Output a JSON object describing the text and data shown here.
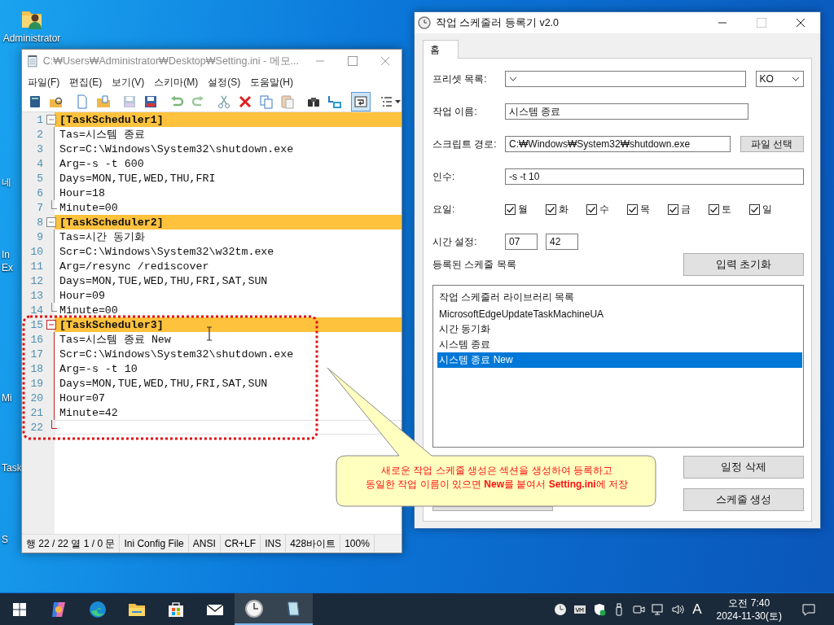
{
  "desktop": {
    "icons": [
      {
        "label": "Administrator"
      }
    ],
    "edge_labels": [
      "네",
      "In",
      "Ex",
      "Mi",
      "Task",
      "S"
    ]
  },
  "notepad": {
    "title": "C:₩Users₩Administrator₩Desktop₩Setting.ini - 메모...",
    "menu": [
      "파일(F)",
      "편집(E)",
      "보기(V)",
      "스키마(M)",
      "설정(S)",
      "도움말(H)"
    ],
    "toolbar": [
      {
        "kind": "book",
        "pressed": false
      },
      {
        "kind": "open",
        "pressed": false
      },
      {
        "kind": "sep"
      },
      {
        "kind": "new",
        "pressed": false
      },
      {
        "kind": "folder",
        "pressed": false
      },
      {
        "kind": "sep"
      },
      {
        "kind": "save-grey",
        "pressed": false
      },
      {
        "kind": "save",
        "pressed": false
      },
      {
        "kind": "sep"
      },
      {
        "kind": "undo",
        "pressed": false
      },
      {
        "kind": "redo",
        "pressed": false
      },
      {
        "kind": "sep"
      },
      {
        "kind": "cut",
        "pressed": false
      },
      {
        "kind": "delete",
        "pressed": false
      },
      {
        "kind": "copy",
        "pressed": false
      },
      {
        "kind": "paste",
        "pressed": false
      },
      {
        "kind": "sep"
      },
      {
        "kind": "find",
        "pressed": false
      },
      {
        "kind": "replace",
        "pressed": false
      },
      {
        "kind": "sep"
      },
      {
        "kind": "wrap",
        "pressed": true
      },
      {
        "kind": "sep"
      },
      {
        "kind": "list",
        "pressed": false
      }
    ],
    "lines": [
      {
        "number": "1",
        "text": "[TaskScheduler1]",
        "kind": "section",
        "current": false
      },
      {
        "number": "2",
        "text": "Tas=시스템 종료",
        "kind": "entry",
        "current": false
      },
      {
        "number": "3",
        "text": "Scr=C:\\Windows\\System32\\shutdown.exe",
        "kind": "entry",
        "current": false
      },
      {
        "number": "4",
        "text": "Arg=-s -t 600",
        "kind": "entry",
        "current": false
      },
      {
        "number": "5",
        "text": "Days=MON,TUE,WED,THU,FRI",
        "kind": "entry",
        "current": false
      },
      {
        "number": "6",
        "text": "Hour=18",
        "kind": "entry",
        "current": false
      },
      {
        "number": "7",
        "text": "Minute=00",
        "kind": "entry",
        "current": false
      },
      {
        "number": "8",
        "text": "[TaskScheduler2]",
        "kind": "section",
        "current": false
      },
      {
        "number": "9",
        "text": "Tas=시간 동기화",
        "kind": "entry",
        "current": false
      },
      {
        "number": "10",
        "text": "Scr=C:\\Windows\\System32\\w32tm.exe",
        "kind": "entry",
        "current": false
      },
      {
        "number": "11",
        "text": "Arg=/resync /rediscover",
        "kind": "entry",
        "current": false
      },
      {
        "number": "12",
        "text": "Days=MON,TUE,WED,THU,FRI,SAT,SUN",
        "kind": "entry",
        "current": false
      },
      {
        "number": "13",
        "text": "Hour=09",
        "kind": "entry",
        "current": false
      },
      {
        "number": "14",
        "text": "Minute=00",
        "kind": "entry",
        "current": false
      },
      {
        "number": "15",
        "text": "[TaskScheduler3]",
        "kind": "section",
        "current": false
      },
      {
        "number": "16",
        "text": "Tas=시스템 종료 New",
        "kind": "entry",
        "current": false
      },
      {
        "number": "17",
        "text": "Scr=C:\\Windows\\System32\\shutdown.exe",
        "kind": "entry",
        "current": false
      },
      {
        "number": "18",
        "text": "Arg=-s -t 10",
        "kind": "entry",
        "current": false
      },
      {
        "number": "19",
        "text": "Days=MON,TUE,WED,THU,FRI,SAT,SUN",
        "kind": "entry",
        "current": false
      },
      {
        "number": "20",
        "text": "Hour=07",
        "kind": "entry",
        "current": false
      },
      {
        "number": "21",
        "text": "Minute=42",
        "kind": "entry",
        "current": false
      },
      {
        "number": "22",
        "kind": "blank",
        "current": true
      }
    ],
    "status_bar": [
      "행 22 / 22   열 1 / 0   문",
      "Ini Config File",
      "ANSI",
      "CR+LF",
      "INS",
      "428바이트",
      "100%"
    ]
  },
  "scheduler": {
    "title": "작업 스케줄러 등록기 v2.0",
    "tabs": [
      {
        "label": "홈",
        "selected": true
      }
    ],
    "preset_label": "프리셋 목록:",
    "language": "KO",
    "task_name_label": "작업 이름:",
    "task_name": "시스템 종료",
    "script_label": "스크립트 경로:",
    "script_path": "C:₩Windows₩System32₩shutdown.exe",
    "browse_button": "파일 선택",
    "args_label": "인수:",
    "args": "-s -t 10",
    "days_label": "요일:",
    "days": [
      {
        "label": "월",
        "checked": true
      },
      {
        "label": "화",
        "checked": true
      },
      {
        "label": "수",
        "checked": true
      },
      {
        "label": "목",
        "checked": true
      },
      {
        "label": "금",
        "checked": true
      },
      {
        "label": "토",
        "checked": true
      },
      {
        "label": "일",
        "checked": true
      }
    ],
    "time_label": "시간 설정:",
    "hour": "07",
    "minute": "42",
    "list_label": "등록된 스케줄 목록",
    "reset_button": "입력 초기화",
    "list_header": "작업 스케줄러 라이브러리 목록",
    "schedules": [
      {
        "label": "MicrosoftEdgeUpdateTaskMachineUA",
        "selected": false
      },
      {
        "label": "시간 동기화",
        "selected": false
      },
      {
        "label": "시스템 종료",
        "selected": false
      },
      {
        "label": "시스템 종료 New",
        "selected": true
      }
    ],
    "delete_button": "일정 삭제",
    "create_button": "스케줄 생성"
  },
  "callout": {
    "lines": [
      "새로운 작업 스케줄 생성은 섹션을 생성하여 등록하고",
      "동일한 작업 이름이 있으면 **New**를 붙여서 **Setting.ini**에 저장"
    ]
  },
  "taskbar": {
    "apps": [
      {
        "kind": "copilot",
        "active": false
      },
      {
        "kind": "edge",
        "active": false
      },
      {
        "kind": "folder",
        "active": false
      },
      {
        "kind": "store",
        "active": false
      },
      {
        "kind": "mail",
        "active": false
      },
      {
        "kind": "clock",
        "active": true
      },
      {
        "kind": "notepad",
        "active": true
      }
    ],
    "ime": "A",
    "time": "오전 7:40",
    "date": "2024-11-30(토)"
  }
}
